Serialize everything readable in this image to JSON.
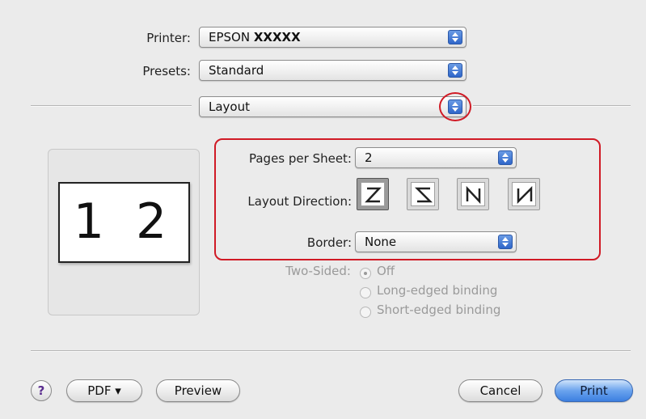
{
  "printer": {
    "label": "Printer:",
    "value_prefix": "EPSON ",
    "value_bold": "XXXXX"
  },
  "presets": {
    "label": "Presets:",
    "value": "Standard"
  },
  "panel": {
    "value": "Layout"
  },
  "preview": {
    "pages": "1 2"
  },
  "layout": {
    "pages_per_sheet": {
      "label": "Pages per Sheet:",
      "value": "2"
    },
    "layout_direction": {
      "label": "Layout Direction:",
      "selected_index": 0
    },
    "border": {
      "label": "Border:",
      "value": "None"
    }
  },
  "two_sided": {
    "label": "Two-Sided:",
    "options": [
      "Off",
      "Long-edged binding",
      "Short-edged binding"
    ],
    "selected": "Off"
  },
  "footer": {
    "help": "?",
    "pdf": "PDF ▾",
    "preview": "Preview",
    "cancel": "Cancel",
    "print": "Print"
  },
  "colors": {
    "highlight": "#d01a25",
    "accent": "#3c7fe0"
  }
}
